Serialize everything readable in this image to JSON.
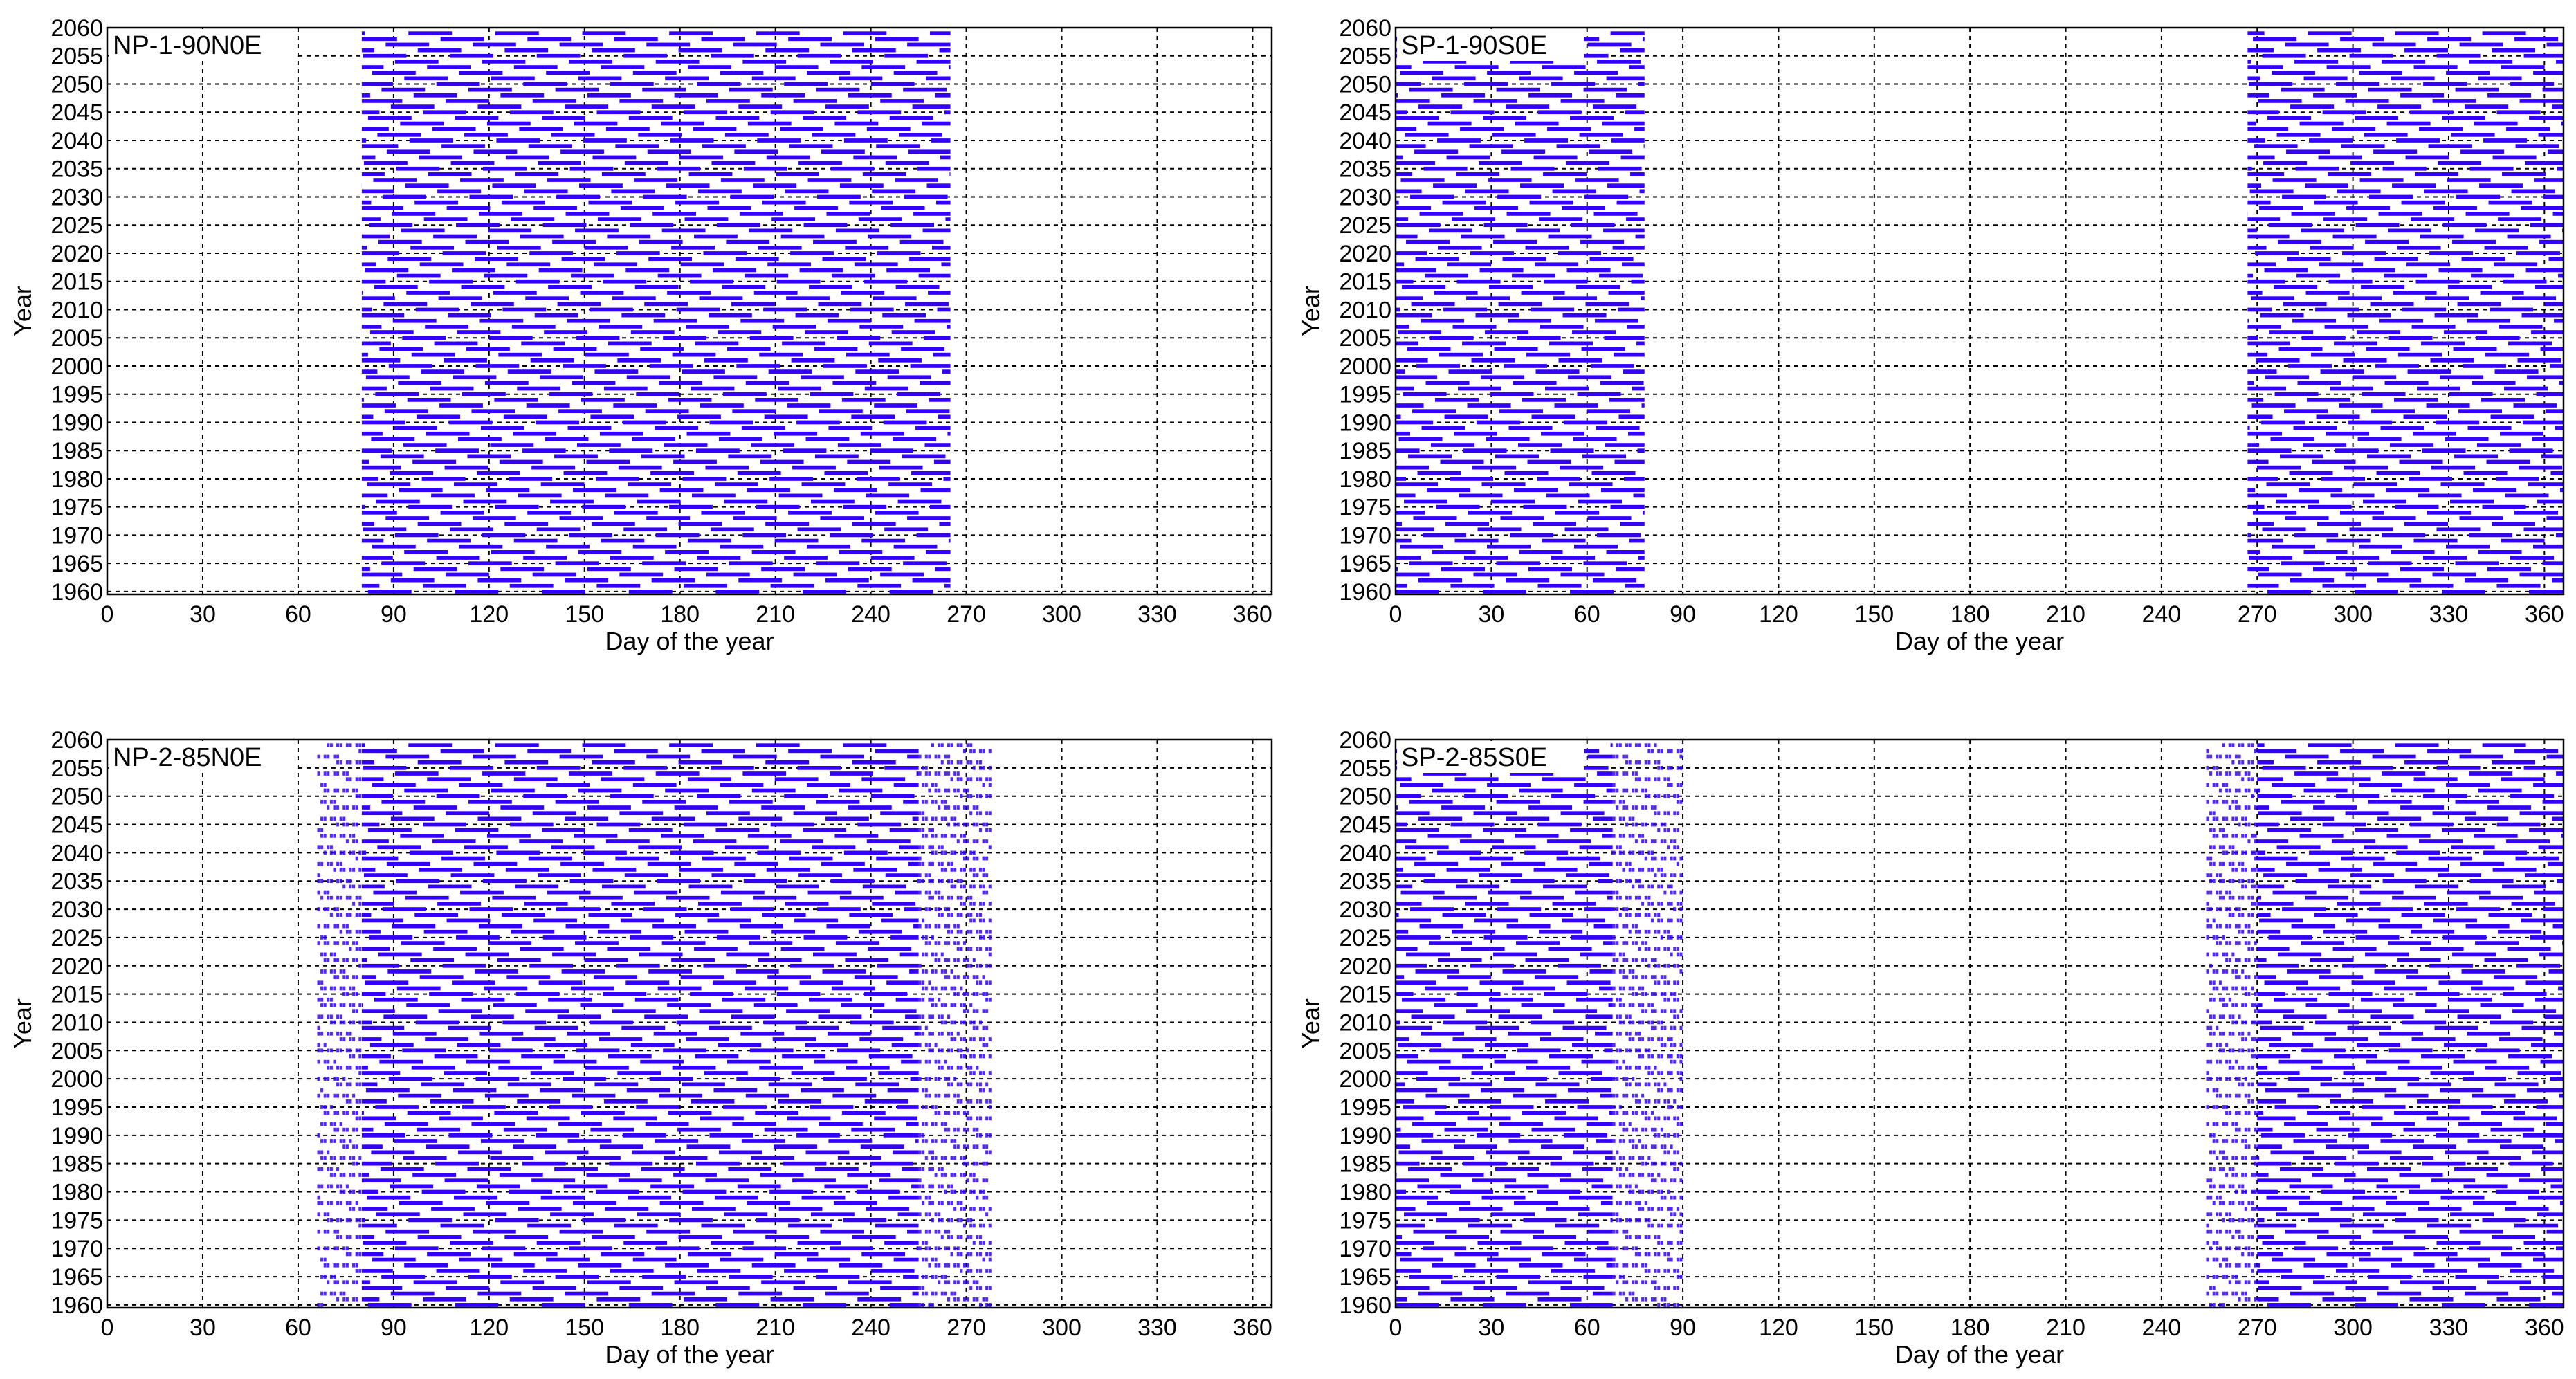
{
  "chart_data": [
    {
      "type": "bar",
      "title": "NP-1-90N0E",
      "xlabel": "Day of the year",
      "ylabel": "Year",
      "xlim": [
        0,
        366
      ],
      "ylim": [
        1959.5,
        2060
      ],
      "grid": true,
      "x_ticks": [
        "0",
        "30",
        "60",
        "90",
        "120",
        "150",
        "180",
        "210",
        "240",
        "270",
        "300",
        "330",
        "360"
      ],
      "y_ticks": [
        "1960",
        "1965",
        "1970",
        "1975",
        "1980",
        "1985",
        "1990",
        "1995",
        "2000",
        "2005",
        "2010",
        "2015",
        "2020",
        "2025",
        "2030",
        "2035",
        "2040",
        "2045",
        "2050",
        "2055",
        "2060"
      ],
      "years": [
        1960,
        2059
      ],
      "active_day_ranges": [
        [
          80,
          265
        ]
      ],
      "fringe_day_ranges": [],
      "segment_period_days": 27.32,
      "segment_length_days": 13.66,
      "color": "#3300ff"
    },
    {
      "type": "bar",
      "title": "SP-1-90S0E",
      "xlabel": "Day of the year",
      "ylabel": "Year",
      "xlim": [
        0,
        366
      ],
      "ylim": [
        1959.5,
        2060
      ],
      "grid": true,
      "x_ticks": [
        "0",
        "30",
        "60",
        "90",
        "120",
        "150",
        "180",
        "210",
        "240",
        "270",
        "300",
        "330",
        "360"
      ],
      "y_ticks": [
        "1960",
        "1965",
        "1970",
        "1975",
        "1980",
        "1985",
        "1990",
        "1995",
        "2000",
        "2005",
        "2010",
        "2015",
        "2020",
        "2025",
        "2030",
        "2035",
        "2040",
        "2045",
        "2050",
        "2055",
        "2060"
      ],
      "years": [
        1960,
        2059
      ],
      "active_day_ranges": [
        [
          0,
          78
        ],
        [
          267,
          366
        ]
      ],
      "fringe_day_ranges": [],
      "segment_period_days": 27.32,
      "segment_length_days": 13.66,
      "color": "#3300ff"
    },
    {
      "type": "bar",
      "title": "NP-2-85N0E",
      "xlabel": "Day of the year",
      "ylabel": "Year",
      "xlim": [
        0,
        366
      ],
      "ylim": [
        1959.5,
        2060
      ],
      "grid": true,
      "x_ticks": [
        "0",
        "30",
        "60",
        "90",
        "120",
        "150",
        "180",
        "210",
        "240",
        "270",
        "300",
        "330",
        "360"
      ],
      "y_ticks": [
        "1960",
        "1965",
        "1970",
        "1975",
        "1980",
        "1985",
        "1990",
        "1995",
        "2000",
        "2005",
        "2010",
        "2015",
        "2020",
        "2025",
        "2030",
        "2035",
        "2040",
        "2045",
        "2050",
        "2055",
        "2060"
      ],
      "years": [
        1960,
        2059
      ],
      "active_day_ranges": [
        [
          80,
          255
        ]
      ],
      "fringe_day_ranges": [
        [
          66,
          80
        ],
        [
          255,
          278
        ]
      ],
      "segment_period_days": 27.32,
      "segment_length_days": 13.66,
      "color": "#3300ff"
    },
    {
      "type": "bar",
      "title": "SP-2-85S0E",
      "xlabel": "Day of the year",
      "ylabel": "Year",
      "xlim": [
        0,
        366
      ],
      "ylim": [
        1959.5,
        2060
      ],
      "grid": true,
      "x_ticks": [
        "0",
        "30",
        "60",
        "90",
        "120",
        "150",
        "180",
        "210",
        "240",
        "270",
        "300",
        "330",
        "360"
      ],
      "y_ticks": [
        "1960",
        "1965",
        "1970",
        "1975",
        "1980",
        "1985",
        "1990",
        "1995",
        "2000",
        "2005",
        "2010",
        "2015",
        "2020",
        "2025",
        "2030",
        "2035",
        "2040",
        "2045",
        "2050",
        "2055",
        "2060"
      ],
      "years": [
        1960,
        2059
      ],
      "active_day_ranges": [
        [
          0,
          68
        ],
        [
          270,
          366
        ]
      ],
      "fringe_day_ranges": [
        [
          68,
          90
        ],
        [
          254,
          270
        ]
      ],
      "segment_period_days": 27.32,
      "segment_length_days": 13.66,
      "color": "#3300ff"
    }
  ]
}
